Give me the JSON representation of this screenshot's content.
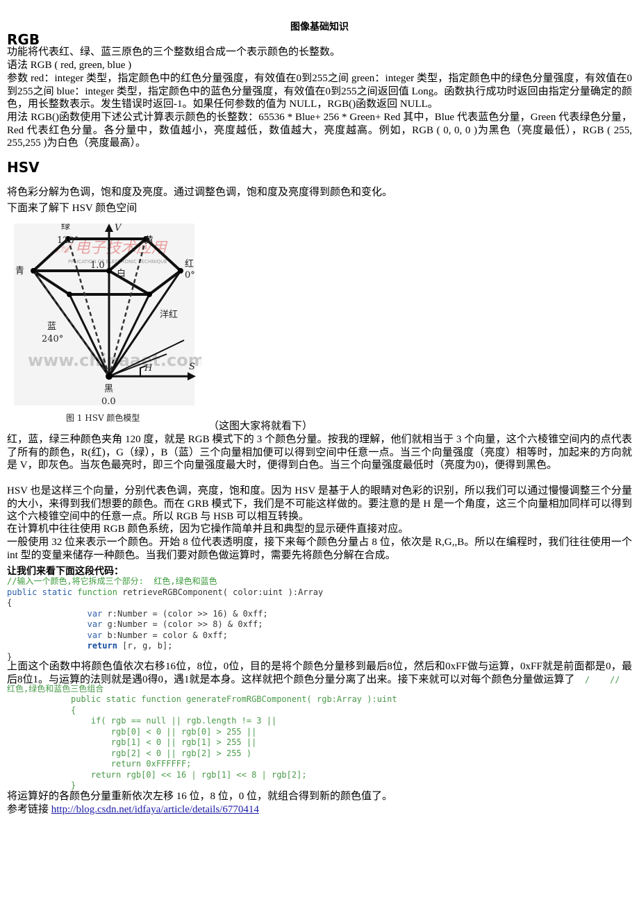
{
  "document": {
    "title": "图像基础知识",
    "rgb_section": {
      "heading": "RGB",
      "paragraphs": [
        "功能将代表红、绿、蓝三原色的三个整数组合成一个表示颜色的长整数。",
        "语法 RGB ( red, green, blue )",
        "参数 red：integer 类型，指定颜色中的红色分量强度，有效值在0到255之间 green：integer 类型，指定颜色中的绿色分量强度，有效值在0到255之间 blue：integer 类型，指定颜色中的蓝色分量强度，有效值在0到255之间返回值 Long。函数执行成功时返回由指定分量确定的颜色，用长整数表示。发生错误时返回-1。如果任何参数的值为 NULL，RGB()函数返回 NULL。",
        "用法 RGB()函数使用下述公式计算表示颜色的长整数：65536 * Blue+ 256 * Green+ Red 其中，Blue 代表蓝色分量，Green 代表绿色分量，Red 代表红色分量。各分量中，数值越小，亮度越低，数值越大，亮度越高。例如，RGB ( 0, 0, 0 )为黑色（亮度最低），RGB ( 255, 255,255 )为白色（亮度最高）。"
      ]
    },
    "hsv_section": {
      "heading": "HSV",
      "intro": "将色彩分解为色调，饱和度及亮度。通过调整色调，饱和度及亮度得到颜色和变化。",
      "lead": "下面来了解下 HSV 颜色空间",
      "figure": {
        "labels": {
          "green": "绿",
          "green_deg": "120°",
          "yellow": "黄",
          "cyan": "青",
          "white": "白",
          "red": "红",
          "red_deg": "0°",
          "v_axis": "V",
          "v_top": "1.0",
          "magenta": "洋红",
          "blue": "蓝",
          "blue_deg": "240°",
          "black": "黑",
          "v_bottom": "0.0",
          "s_axis": "S",
          "h_angle": "H",
          "watermark_top": "PPLICATION OF ELECTRONIC TECHNIQUE",
          "watermark_mid": "www.chinaaet.com",
          "caption": "图 1   HSV 颜色模型"
        }
      },
      "figure_note": "（这图大家将就看下）",
      "paragraphs": [
        "红，蓝，绿三种颜色夹角 120 度，就是 RGB 模式下的 3 个颜色分量。按我的理解，他们就相当于 3 个向量，这个六棱锥空间内的点代表了所有的颜色，R(红)，G（绿），B（蓝）三个向量相加便可以得到空间中任意一点。当三个向量强度（亮度）相等时，加起来的方向就是 V，即灰色。当灰色最亮时，即三个向量强度最大时，便得到白色。当三个向量强度最低时（亮度为0)，便得到黑色。",
        "HSV 也是这样三个向量，分别代表色调，亮度，饱和度。因为 HSV 是基于人的眼睛对色彩的识别，所以我们可以通过慢慢调整三个分量的大小，来得到我们想要的颜色。而在 GRB 模式下，我们是不可能这样做的。要注意的是 H 是一个角度，这三个向量相加同样可以得到这个六棱锥空间中的任意一点。所以 RGB 与 HSB 可以相互转换。",
        "在计算机中往往使用 RGB 颜色系统，因为它操作简单并且和典型的显示硬件直接对应。",
        "一般使用 32 位来表示一个颜色。开始 8 位代表透明度，接下来每个颜色分量占 8 位，依次是 R,G,,B。所以在编程时，我们往往使用一个 int 型的变量来储存一种颜色。当我们要对颜色做运算时，需要先将颜色分解在合成。"
      ],
      "code_intro": "让我们来看下面这段代码：",
      "code1": {
        "comment": "//输入一个颜色,将它拆成三个部分:  红色,绿色和蓝色",
        "kw_public": "public",
        "kw_static": "static",
        "kw_function": "function",
        "signature": " retrieveRGBComponent( color:uint ):Array",
        "open_brace": "{",
        "kw_var": "var",
        "line_r": " r:Number = (color >> 16) & 0xff;",
        "line_g": " g:Number = (color >> 8) & 0xff;",
        "line_b": " b:Number = color & 0xff;",
        "kw_return": "return",
        "line_ret": " [r, g, b];",
        "close_brace": "}"
      },
      "explain1": "上面这个函数中将颜色值依次右移16位，8位，0位，目的是将个颜色分量移到最后8位，然后和0xFF做与运算，0xFF就是前面都是0，最后8位1。与运算的法则就是遇0得0，遇1就是本身。这样就把个颜色分量分离了出来。接下来就可以对每个颜色分量做运算了",
      "explain1_tail": "  /    //",
      "code2": {
        "comment": "红色,绿色和蓝色三色组合",
        "lines": [
          "public static function generateFromRGBComponent( rgb:Array ):uint",
          "{",
          "    if( rgb == null || rgb.length != 3 ||",
          "        rgb[0] < 0 || rgb[0] > 255 ||",
          "        rgb[1] < 0 || rgb[1] > 255 ||",
          "        rgb[2] < 0 || rgb[2] > 255 )",
          "        return 0xFFFFFF;",
          "    return rgb[0] << 16 | rgb[1] << 8 | rgb[2];",
          "}"
        ]
      },
      "explain2": "将运算好的各颜色分量重新依次左移 16 位，8 位，0 位，就组合得到新的颜色值了。",
      "reference_label": "参考链接 ",
      "reference_link": "http://blog.csdn.net/idfaya/article/details/6770414"
    }
  }
}
